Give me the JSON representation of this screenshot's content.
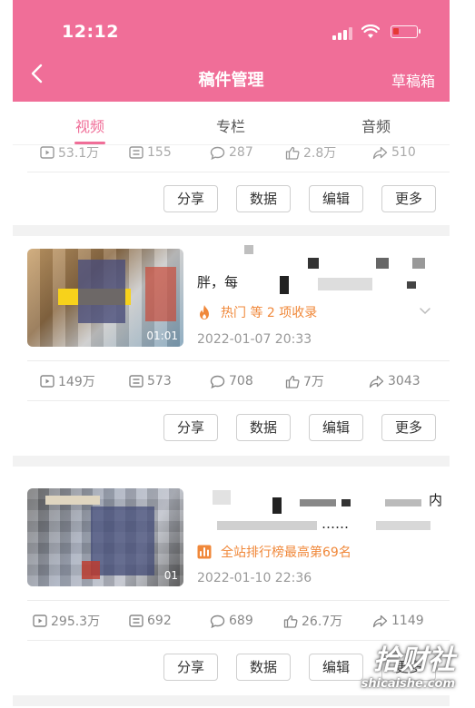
{
  "status_bar": {
    "time": "12:12"
  },
  "nav": {
    "title": "稿件管理",
    "right_action": "草稿箱"
  },
  "tabs": [
    {
      "label": "视频",
      "active": true
    },
    {
      "label": "专栏",
      "active": false
    },
    {
      "label": "音频",
      "active": false
    }
  ],
  "actions": {
    "share": "分享",
    "data": "数据",
    "edit": "编辑",
    "more": "更多"
  },
  "top_card_stats": {
    "plays": "53.1万",
    "danmaku": "155",
    "comments": "287",
    "likes": "2.8万",
    "shares": "510"
  },
  "videos": [
    {
      "duration": "01:01",
      "title_fragment": "胖，每",
      "badge_icon": "fire-icon",
      "badge_text": "热门 等 2 项收录",
      "date": "2022-01-07 20:33",
      "stats": {
        "plays": "149万",
        "danmaku": "573",
        "comments": "708",
        "likes": "7万",
        "shares": "3043"
      }
    },
    {
      "duration": "01",
      "title_fragment": "……",
      "badge_icon": "ranking-icon",
      "badge_text": "全站排行榜最高第69名",
      "date": "2022-01-10 22:36",
      "stats": {
        "plays": "295.3万",
        "danmaku": "692",
        "comments": "689",
        "likes": "26.7万",
        "shares": "1149"
      }
    }
  ],
  "watermark": {
    "main": "拾财社",
    "sub": "shicaishe.com"
  },
  "colors": {
    "accent": "#f06e98",
    "hot": "#f0883a",
    "battery_low": "#e53935"
  }
}
